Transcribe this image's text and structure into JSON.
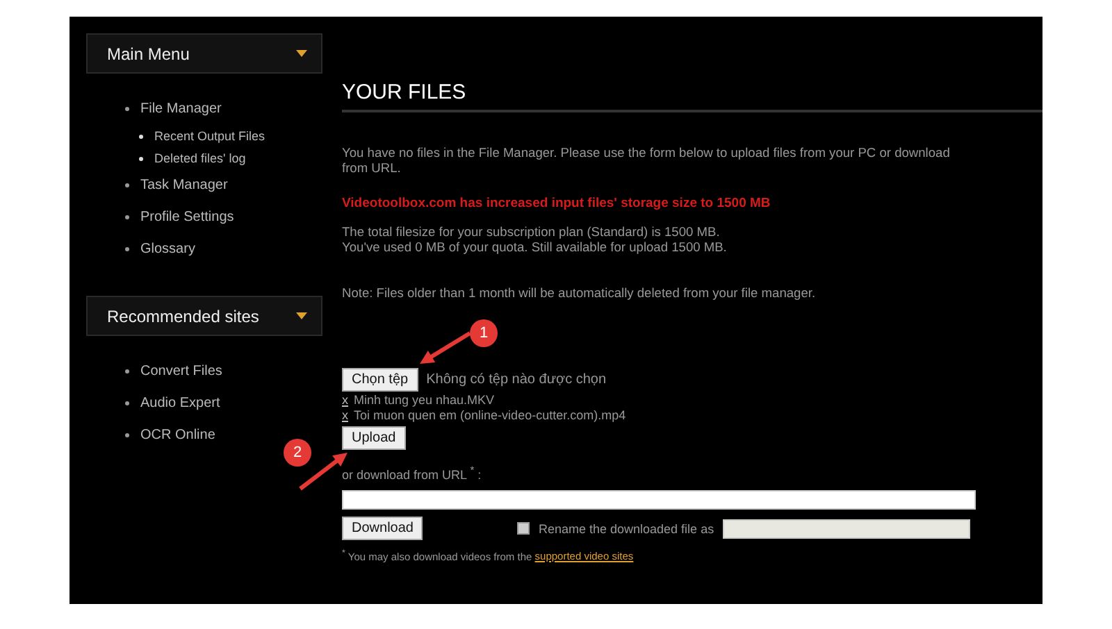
{
  "sidebar": {
    "menus": [
      {
        "title": "Main Menu",
        "items": [
          {
            "label": "File Manager",
            "children": [
              {
                "label": "Recent Output Files"
              },
              {
                "label": "Deleted files' log"
              }
            ]
          },
          {
            "label": "Task Manager"
          },
          {
            "label": "Profile Settings"
          },
          {
            "label": "Glossary"
          }
        ]
      },
      {
        "title": "Recommended sites",
        "items": [
          {
            "label": "Convert Files"
          },
          {
            "label": "Audio Expert"
          },
          {
            "label": "OCR Online"
          }
        ]
      }
    ]
  },
  "content": {
    "title": "YOUR FILES",
    "intro": "You have no files in the File Manager. Please use the form below to upload files from your PC or download from URL.",
    "notice": "Videotoolbox.com has increased input files' storage size to 1500 MB",
    "quota_lines": [
      "The total filesize for your subscription plan (Standard) is 1500 MB.",
      "You've used 0 MB of your quota. Still available for upload 1500 MB."
    ],
    "note": "Note: Files older than 1 month will be automatically deleted from your file manager.",
    "file_button": "Chọn tệp",
    "file_status": "Không có tệp nào được chọn",
    "files": [
      {
        "remove": "x",
        "name": "Minh tung yeu nhau.MKV"
      },
      {
        "remove": "x",
        "name": "Toi muon quen em (online-video-cutter.com).mp4"
      }
    ],
    "upload_button": "Upload",
    "url_label": "or download from URL $^{*}$ :",
    "download_button": "Download",
    "rename": {
      "label": "Rename the downloaded file as",
      "checked": false
    },
    "footnote": "$^{*}$ You may also download videos from the ",
    "footnote_link": "supported video sites"
  },
  "annotations": [
    {
      "number": "1"
    },
    {
      "number": "2"
    }
  ]
}
